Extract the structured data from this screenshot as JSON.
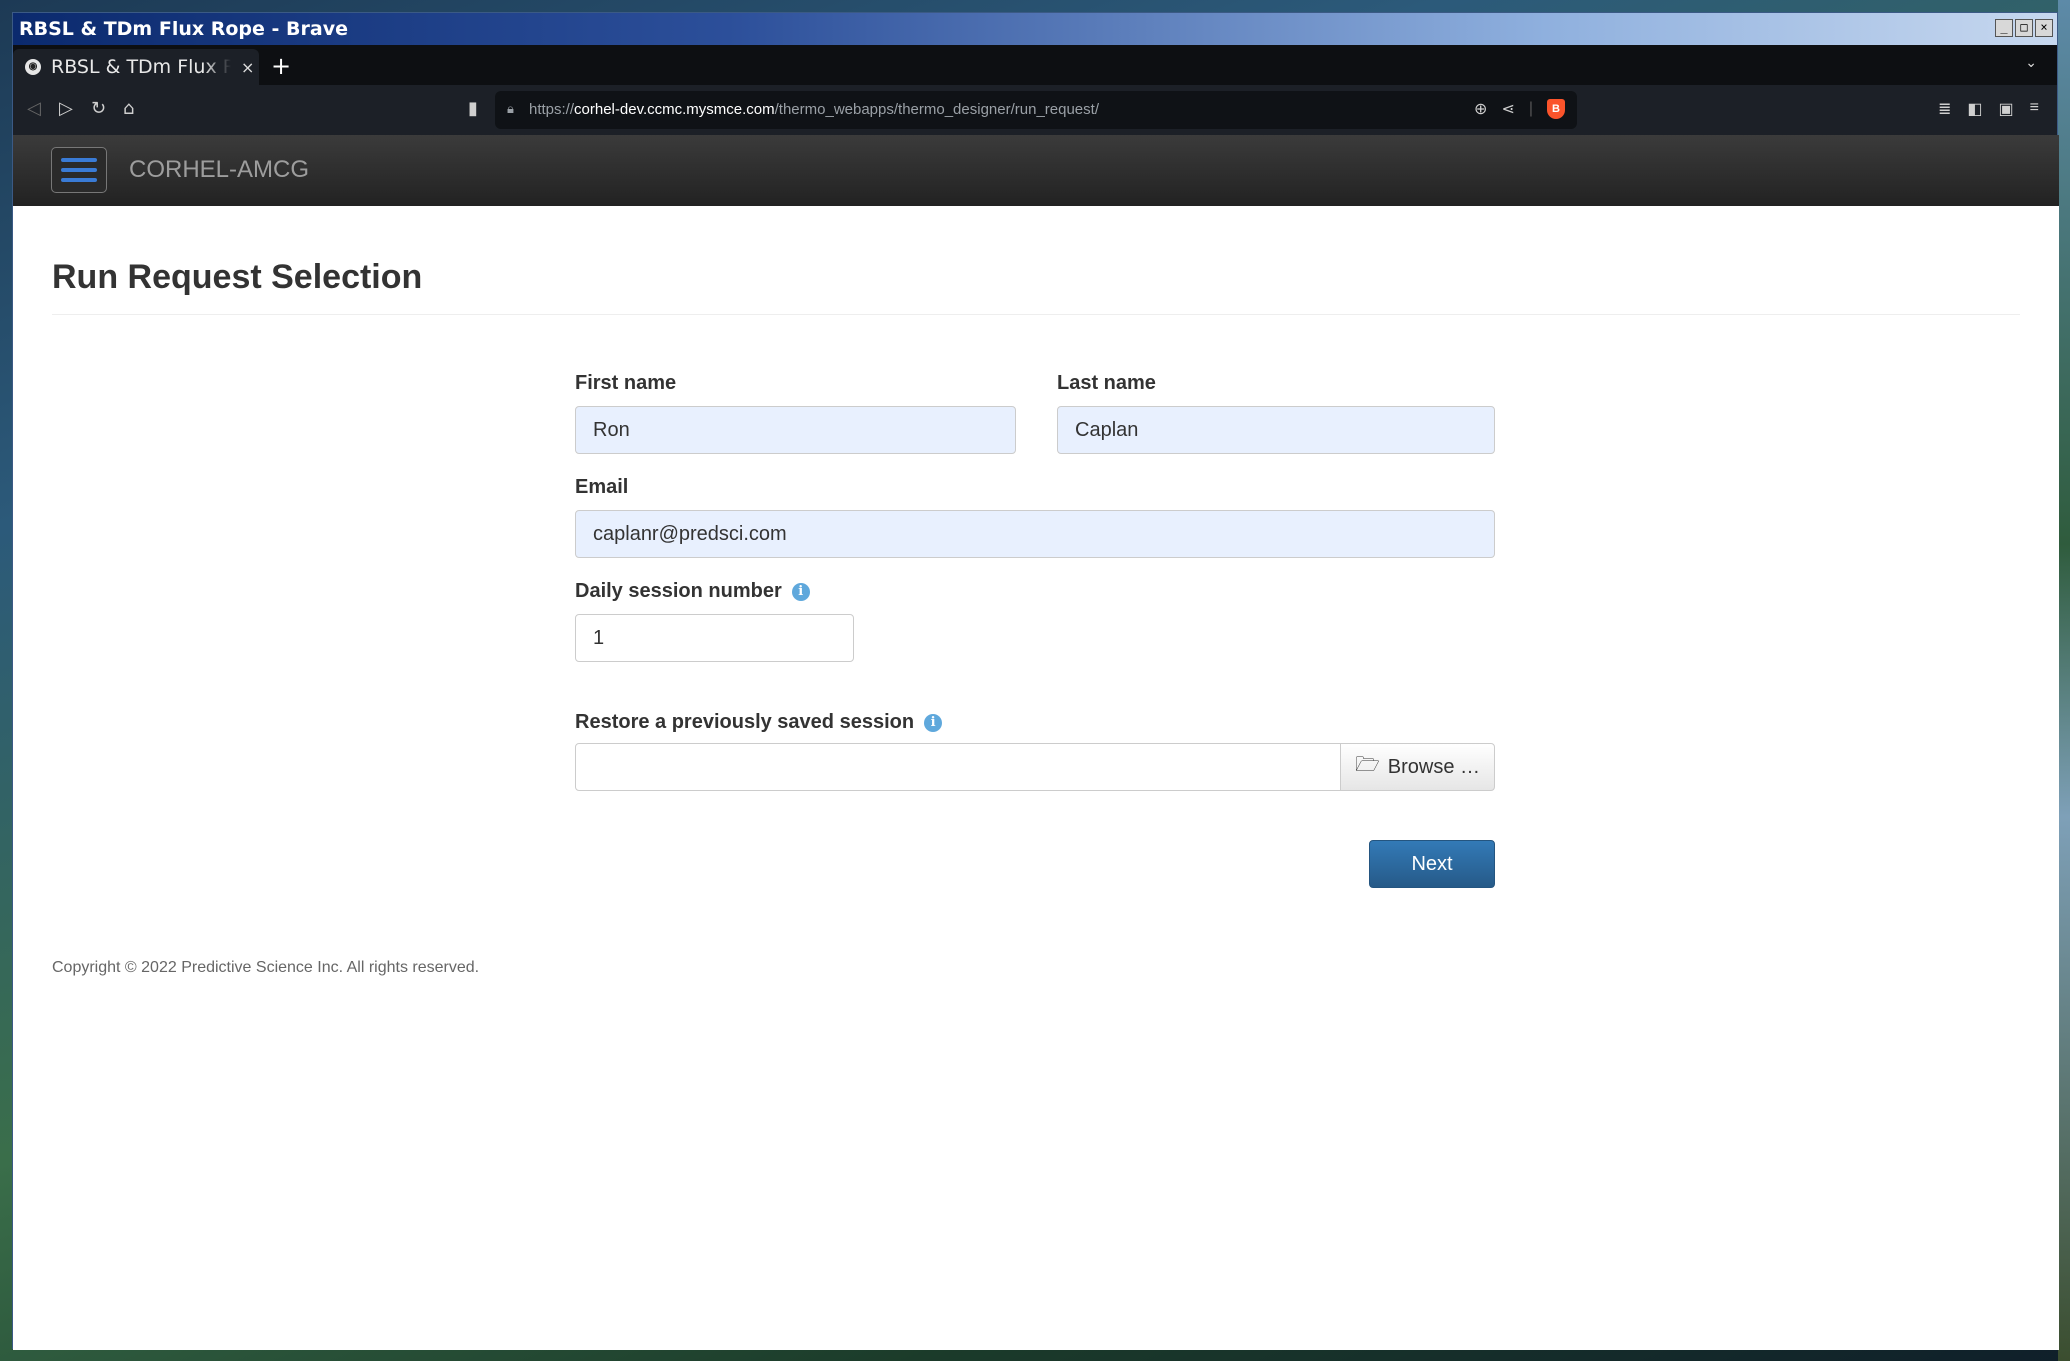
{
  "window": {
    "title": "RBSL & TDm Flux Rope - Brave",
    "controls": [
      "_",
      "□",
      "×"
    ]
  },
  "tabs": [
    {
      "title": "RBSL & TDm Flux Rope - Brave",
      "close": "×"
    }
  ],
  "tabstrip": {
    "new_tab": "+",
    "tab_list": "⌄"
  },
  "toolbar": {
    "url_host": "corhel-dev.ccmc.mysmce.com",
    "url_scheme": "https://",
    "url_path": "/thermo_webapps/thermo_designer/run_request/"
  },
  "app": {
    "brand": "CORHEL-AMCG"
  },
  "page": {
    "title": "Run Request Selection"
  },
  "form": {
    "first_name_label": "First name",
    "first_name_value": "Ron",
    "last_name_label": "Last name",
    "last_name_value": "Caplan",
    "email_label": "Email",
    "email_value": "caplanr@predsci.com",
    "session_label": "Daily session number",
    "session_value": "1",
    "restore_label": "Restore a previously saved session",
    "browse_label": "Browse …",
    "next_label": "Next"
  },
  "footer": {
    "copyright": "Copyright © 2022 Predictive Science Inc. All rights reserved."
  },
  "colors": {
    "primary_button": "#337ab7",
    "navbar": "#222222",
    "autofill_bg": "#e8f0fe",
    "info_icon": "#5fa8dc"
  }
}
